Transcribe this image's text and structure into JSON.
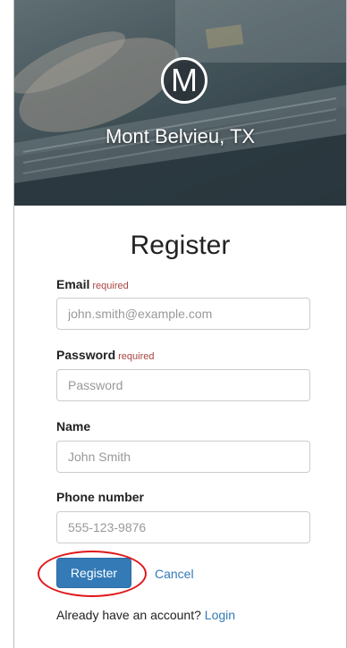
{
  "header": {
    "logo_letter": "M",
    "city": "Mont Belvieu, TX"
  },
  "form": {
    "title": "Register",
    "required_text": "required",
    "email": {
      "label": "Email",
      "placeholder": "john.smith@example.com"
    },
    "password": {
      "label": "Password",
      "placeholder": "Password"
    },
    "name": {
      "label": "Name",
      "placeholder": "John Smith"
    },
    "phone": {
      "label": "Phone number",
      "placeholder": "555-123-9876"
    },
    "register_label": "Register",
    "cancel_label": "Cancel",
    "login_prompt": "Already have an account?",
    "login_label": "Login"
  },
  "colors": {
    "primary": "#337ab7",
    "required": "#a94442",
    "highlight": "#e0181b"
  }
}
